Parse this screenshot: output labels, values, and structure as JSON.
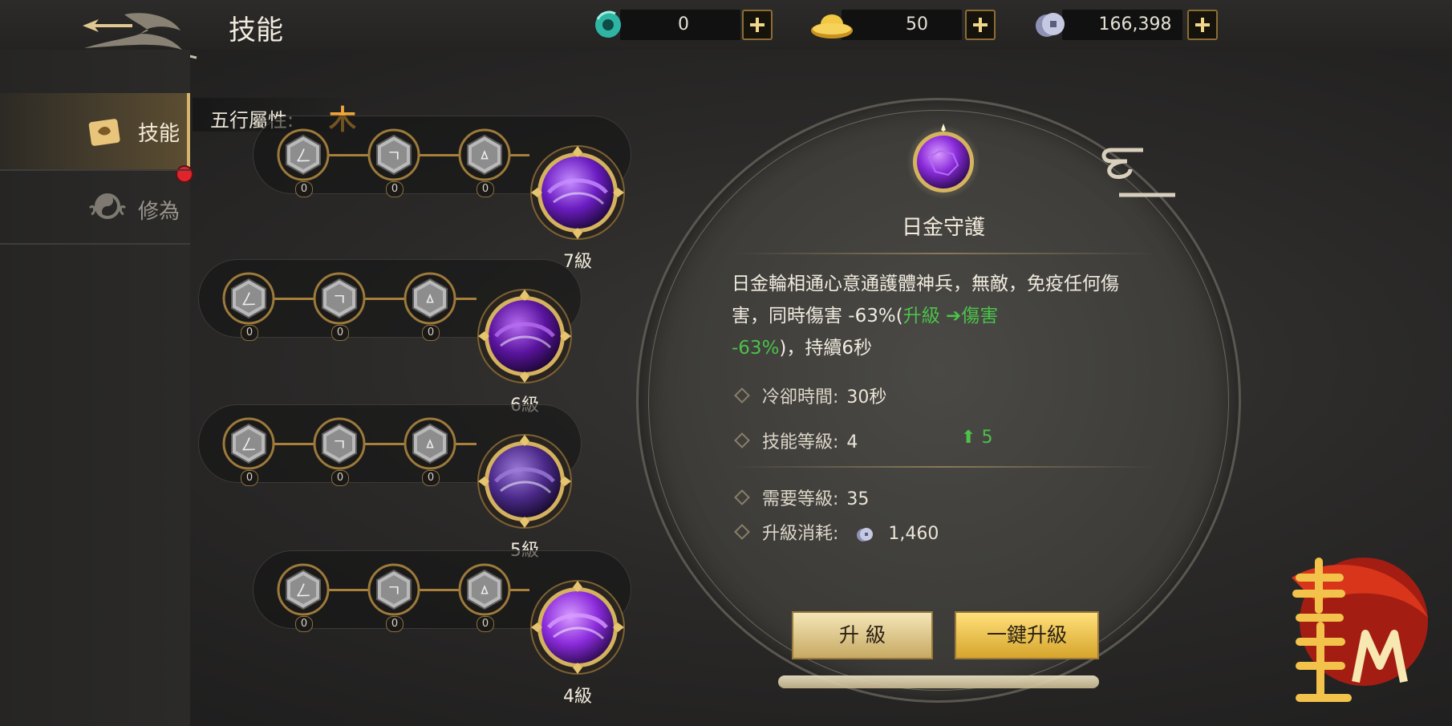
{
  "header": {
    "title": "技能"
  },
  "currencies": [
    {
      "name": "jade",
      "value": "0"
    },
    {
      "name": "gold-ingot",
      "value": "50"
    },
    {
      "name": "silver-coin",
      "value": "166,398"
    }
  ],
  "sidenav": {
    "items": [
      {
        "label": "技能"
      },
      {
        "label": "修為"
      }
    ]
  },
  "attribute": {
    "label": "五行屬性:",
    "value": "木"
  },
  "skills": [
    {
      "level": "7級",
      "nodes": [
        "0",
        "0",
        "0"
      ]
    },
    {
      "level": "6級",
      "nodes": [
        "0",
        "0",
        "0"
      ]
    },
    {
      "level": "5級",
      "nodes": [
        "0",
        "0",
        "0"
      ]
    },
    {
      "level": "4級",
      "nodes": [
        "0",
        "0",
        "0"
      ]
    }
  ],
  "detail": {
    "name": "日金守護",
    "desc1": "日金輪相通心意通護體神兵，無敵，免疫任何傷",
    "desc2a": "害，同時傷害 -63%(",
    "desc2b": "升級",
    "desc2c": "傷害",
    "desc3a": "-63%",
    "desc3b": ")，持續6秒",
    "cooldown_label": "冷卻時間:",
    "cooldown_value": "30秒",
    "level_label": "技能等級:",
    "level_value": "4",
    "level_next": "5",
    "req_label": "需要等級:",
    "req_value": "35",
    "cost_label": "升級消耗:",
    "cost_value": "1,460",
    "btn_upgrade": "升 級",
    "btn_upgrade_all": "一鍵升級"
  },
  "colors": {
    "accent_gold": "#d7b46b",
    "green": "#4cc24a",
    "red": "#e02c2c"
  }
}
